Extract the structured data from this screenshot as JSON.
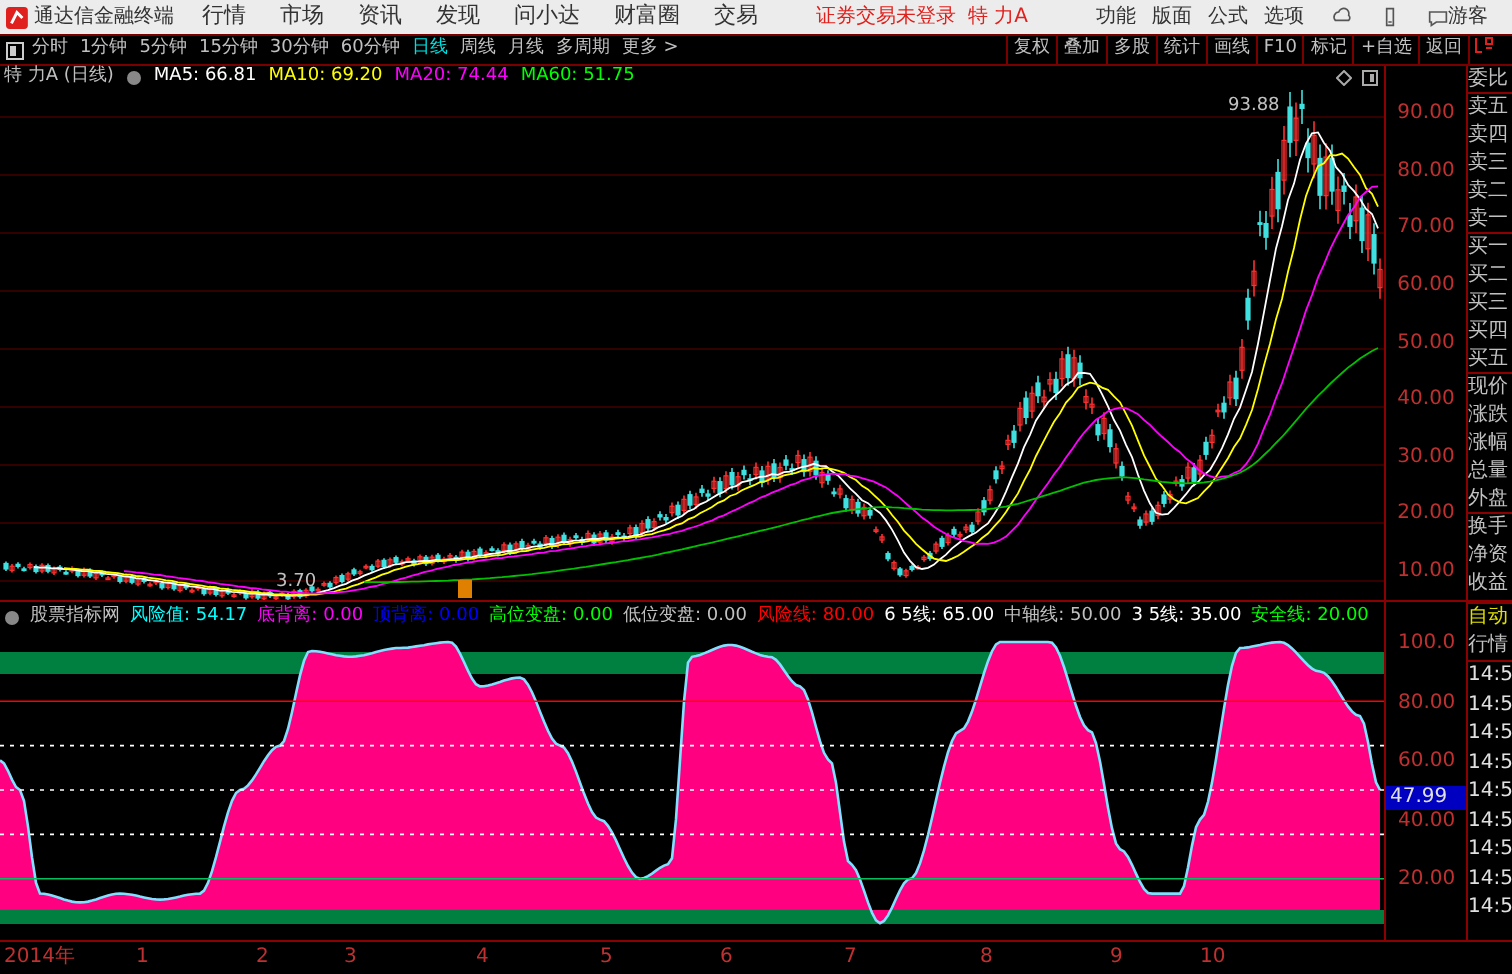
{
  "title_bar": {
    "app_name": "通达信金融终端",
    "menus": [
      "行情",
      "市场",
      "资讯",
      "发现",
      "问小达",
      "财富圈",
      "交易"
    ],
    "login_status": "证券交易未登录",
    "stock": "特 力A",
    "right_menus": [
      "功能",
      "版面",
      "公式",
      "选项"
    ],
    "user": "游客"
  },
  "toolbar": {
    "periods": [
      {
        "label": "分时",
        "selected": false
      },
      {
        "label": "1分钟",
        "selected": false
      },
      {
        "label": "5分钟",
        "selected": false
      },
      {
        "label": "15分钟",
        "selected": false
      },
      {
        "label": "30分钟",
        "selected": false
      },
      {
        "label": "60分钟",
        "selected": false
      },
      {
        "label": "日线",
        "selected": true
      },
      {
        "label": "周线",
        "selected": false
      },
      {
        "label": "月线",
        "selected": false
      },
      {
        "label": "多周期",
        "selected": false
      },
      {
        "label": "更多 >",
        "selected": false
      }
    ],
    "tools": [
      "复权",
      "叠加",
      "多股",
      "统计",
      "画线",
      "F10",
      "标记",
      "+自选",
      "返回"
    ]
  },
  "ma_legend": {
    "stock": "特 力A (日线)",
    "items": [
      {
        "label": "MA5: 66.81",
        "color": "#ffffff"
      },
      {
        "label": "MA10: 69.20",
        "color": "#ffff00"
      },
      {
        "label": "MA20: 74.44",
        "color": "#ff00ff"
      },
      {
        "label": "MA60: 51.75",
        "color": "#00ff00"
      }
    ]
  },
  "price_chart": {
    "high_label": "93.88",
    "low_label": "3.70",
    "axis": [
      "90.00",
      "80.00",
      "70.00",
      "60.00",
      "50.00",
      "40.00",
      "30.00",
      "20.00",
      "10.00"
    ]
  },
  "quote_panel": {
    "labels": [
      "委比",
      "卖五",
      "卖四",
      "卖三",
      "卖二",
      "卖一",
      "买一",
      "买二",
      "买三",
      "买四",
      "买五",
      "现价",
      "涨跌",
      "涨幅",
      "总量",
      "外盘",
      "换手",
      "净资",
      "收益"
    ],
    "mode": "自动",
    "section": "行情",
    "times": [
      "14:5",
      "14:5",
      "14:5",
      "14:5",
      "14:5",
      "14:5",
      "14:5",
      "14:5",
      "14:5"
    ]
  },
  "indicator": {
    "name": "股票指标网",
    "items": [
      {
        "label": "风险值: 54.17",
        "color": "#00ffff"
      },
      {
        "label": "底背离: 0.00",
        "color": "#ff00ff"
      },
      {
        "label": "顶背离: 0.00",
        "color": "#0000ff"
      },
      {
        "label": "高位变盘: 0.00",
        "color": "#00ff00"
      },
      {
        "label": "低位变盘: 0.00",
        "color": "#c0c0c0"
      },
      {
        "label": "风险线: 80.00",
        "color": "#ff0000"
      },
      {
        "label": "6 5线: 65.00",
        "color": "#ffffff"
      },
      {
        "label": "中轴线: 50.00",
        "color": "#c0c0c0"
      },
      {
        "label": "3 5线: 35.00",
        "color": "#ffffff"
      },
      {
        "label": "安全线: 20.00",
        "color": "#00ff00"
      }
    ],
    "axis": [
      "100.0",
      "80.00",
      "60.00",
      "40.00",
      "20.00"
    ],
    "current": "47.99"
  },
  "date_axis": [
    "2014年",
    "1",
    "2",
    "3",
    "4",
    "5",
    "6",
    "7",
    "8",
    "9",
    "10"
  ]
}
